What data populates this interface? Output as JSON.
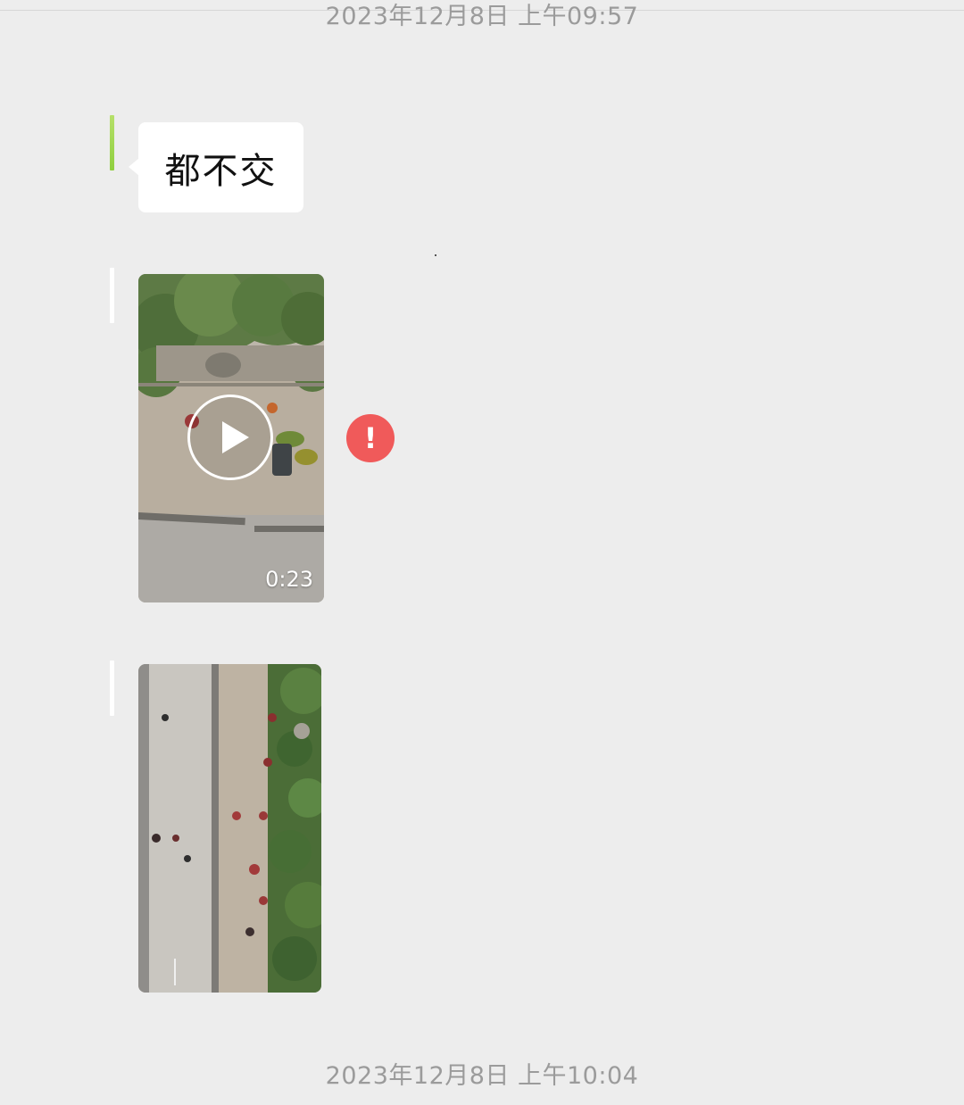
{
  "chat": {
    "timestamp_top": "2023年12月8日 上午09:57",
    "timestamp_bottom": "2023年12月8日 上午10:04",
    "messages": [
      {
        "type": "text",
        "text": "都不交"
      },
      {
        "type": "video",
        "duration": "0:23",
        "status_icon": "error-icon"
      },
      {
        "type": "image"
      }
    ]
  },
  "colors": {
    "background": "#ededed",
    "bubble": "#ffffff",
    "error": "#f05a5a",
    "timestamp": "#9b9b9b"
  }
}
